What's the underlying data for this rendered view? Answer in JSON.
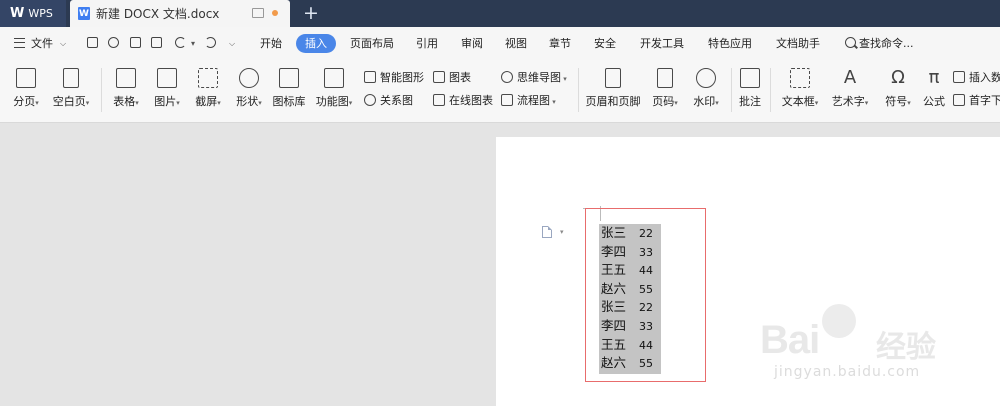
{
  "titlebar": {
    "app_label": "WPS",
    "doc_tab_title": "新建 DOCX 文档.docx",
    "new_tab": "+"
  },
  "menu": {
    "file": "文件",
    "items": [
      "开始",
      "插入",
      "页面布局",
      "引用",
      "审阅",
      "视图",
      "章节",
      "安全",
      "开发工具",
      "特色应用",
      "文档助手"
    ],
    "active": "插入",
    "search": "查找命令..."
  },
  "ribbon": {
    "page_break": "分页",
    "blank_page": "空白页",
    "table": "表格",
    "picture": "图片",
    "screenshot": "截屏",
    "shape": "形状",
    "icon_lib": "图标库",
    "function_chart": "功能图",
    "smart_shape": "智能图形",
    "chart": "图表",
    "mind_map": "思维导图",
    "relation_chart": "关系图",
    "online_chart": "在线图表",
    "flowchart": "流程图",
    "header_footer": "页眉和页脚",
    "page_number": "页码",
    "watermark": "水印",
    "comment": "批注",
    "textbox": "文本框",
    "wordart": "艺术字",
    "symbol": "符号",
    "formula": "公式",
    "insert_num": "插入数",
    "drop_cap": "首字下"
  },
  "document": {
    "rows": [
      {
        "name": "张三",
        "age": "22"
      },
      {
        "name": "李四",
        "age": "33"
      },
      {
        "name": "王五",
        "age": "44"
      },
      {
        "name": "赵六",
        "age": "55"
      },
      {
        "name": "张三",
        "age": "22"
      },
      {
        "name": "李四",
        "age": "33"
      },
      {
        "name": "王五",
        "age": "44"
      },
      {
        "name": "赵六",
        "age": "55"
      }
    ]
  },
  "watermark": {
    "brand": "Bai",
    "brand_cn": "经验",
    "url": "jingyan.baidu.com"
  },
  "colors": {
    "accent": "#4a86e8",
    "titlebar": "#2c3a52",
    "highlight": "#c4c4c4",
    "selection_box": "#e86c6c"
  }
}
